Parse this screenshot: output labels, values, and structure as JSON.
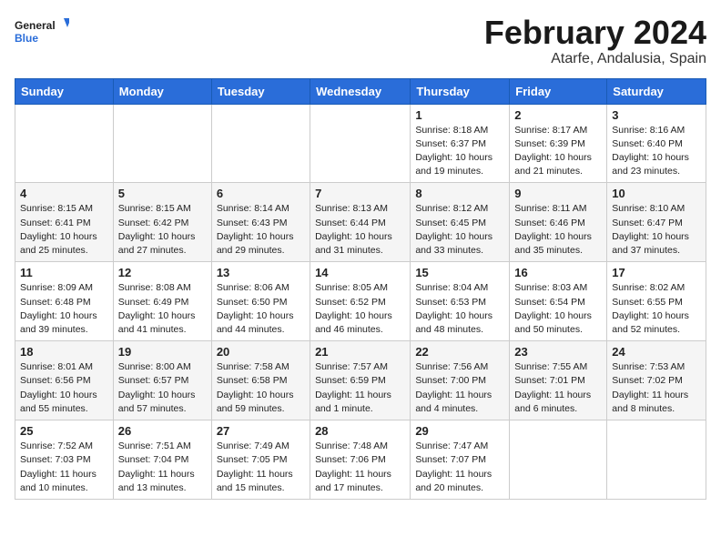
{
  "header": {
    "logo_general": "General",
    "logo_blue": "Blue",
    "month_title": "February 2024",
    "subtitle": "Atarfe, Andalusia, Spain"
  },
  "weekdays": [
    "Sunday",
    "Monday",
    "Tuesday",
    "Wednesday",
    "Thursday",
    "Friday",
    "Saturday"
  ],
  "weeks": [
    [
      {
        "day": "",
        "info": ""
      },
      {
        "day": "",
        "info": ""
      },
      {
        "day": "",
        "info": ""
      },
      {
        "day": "",
        "info": ""
      },
      {
        "day": "1",
        "info": "Sunrise: 8:18 AM\nSunset: 6:37 PM\nDaylight: 10 hours\nand 19 minutes."
      },
      {
        "day": "2",
        "info": "Sunrise: 8:17 AM\nSunset: 6:39 PM\nDaylight: 10 hours\nand 21 minutes."
      },
      {
        "day": "3",
        "info": "Sunrise: 8:16 AM\nSunset: 6:40 PM\nDaylight: 10 hours\nand 23 minutes."
      }
    ],
    [
      {
        "day": "4",
        "info": "Sunrise: 8:15 AM\nSunset: 6:41 PM\nDaylight: 10 hours\nand 25 minutes."
      },
      {
        "day": "5",
        "info": "Sunrise: 8:15 AM\nSunset: 6:42 PM\nDaylight: 10 hours\nand 27 minutes."
      },
      {
        "day": "6",
        "info": "Sunrise: 8:14 AM\nSunset: 6:43 PM\nDaylight: 10 hours\nand 29 minutes."
      },
      {
        "day": "7",
        "info": "Sunrise: 8:13 AM\nSunset: 6:44 PM\nDaylight: 10 hours\nand 31 minutes."
      },
      {
        "day": "8",
        "info": "Sunrise: 8:12 AM\nSunset: 6:45 PM\nDaylight: 10 hours\nand 33 minutes."
      },
      {
        "day": "9",
        "info": "Sunrise: 8:11 AM\nSunset: 6:46 PM\nDaylight: 10 hours\nand 35 minutes."
      },
      {
        "day": "10",
        "info": "Sunrise: 8:10 AM\nSunset: 6:47 PM\nDaylight: 10 hours\nand 37 minutes."
      }
    ],
    [
      {
        "day": "11",
        "info": "Sunrise: 8:09 AM\nSunset: 6:48 PM\nDaylight: 10 hours\nand 39 minutes."
      },
      {
        "day": "12",
        "info": "Sunrise: 8:08 AM\nSunset: 6:49 PM\nDaylight: 10 hours\nand 41 minutes."
      },
      {
        "day": "13",
        "info": "Sunrise: 8:06 AM\nSunset: 6:50 PM\nDaylight: 10 hours\nand 44 minutes."
      },
      {
        "day": "14",
        "info": "Sunrise: 8:05 AM\nSunset: 6:52 PM\nDaylight: 10 hours\nand 46 minutes."
      },
      {
        "day": "15",
        "info": "Sunrise: 8:04 AM\nSunset: 6:53 PM\nDaylight: 10 hours\nand 48 minutes."
      },
      {
        "day": "16",
        "info": "Sunrise: 8:03 AM\nSunset: 6:54 PM\nDaylight: 10 hours\nand 50 minutes."
      },
      {
        "day": "17",
        "info": "Sunrise: 8:02 AM\nSunset: 6:55 PM\nDaylight: 10 hours\nand 52 minutes."
      }
    ],
    [
      {
        "day": "18",
        "info": "Sunrise: 8:01 AM\nSunset: 6:56 PM\nDaylight: 10 hours\nand 55 minutes."
      },
      {
        "day": "19",
        "info": "Sunrise: 8:00 AM\nSunset: 6:57 PM\nDaylight: 10 hours\nand 57 minutes."
      },
      {
        "day": "20",
        "info": "Sunrise: 7:58 AM\nSunset: 6:58 PM\nDaylight: 10 hours\nand 59 minutes."
      },
      {
        "day": "21",
        "info": "Sunrise: 7:57 AM\nSunset: 6:59 PM\nDaylight: 11 hours\nand 1 minute."
      },
      {
        "day": "22",
        "info": "Sunrise: 7:56 AM\nSunset: 7:00 PM\nDaylight: 11 hours\nand 4 minutes."
      },
      {
        "day": "23",
        "info": "Sunrise: 7:55 AM\nSunset: 7:01 PM\nDaylight: 11 hours\nand 6 minutes."
      },
      {
        "day": "24",
        "info": "Sunrise: 7:53 AM\nSunset: 7:02 PM\nDaylight: 11 hours\nand 8 minutes."
      }
    ],
    [
      {
        "day": "25",
        "info": "Sunrise: 7:52 AM\nSunset: 7:03 PM\nDaylight: 11 hours\nand 10 minutes."
      },
      {
        "day": "26",
        "info": "Sunrise: 7:51 AM\nSunset: 7:04 PM\nDaylight: 11 hours\nand 13 minutes."
      },
      {
        "day": "27",
        "info": "Sunrise: 7:49 AM\nSunset: 7:05 PM\nDaylight: 11 hours\nand 15 minutes."
      },
      {
        "day": "28",
        "info": "Sunrise: 7:48 AM\nSunset: 7:06 PM\nDaylight: 11 hours\nand 17 minutes."
      },
      {
        "day": "29",
        "info": "Sunrise: 7:47 AM\nSunset: 7:07 PM\nDaylight: 11 hours\nand 20 minutes."
      },
      {
        "day": "",
        "info": ""
      },
      {
        "day": "",
        "info": ""
      }
    ]
  ]
}
